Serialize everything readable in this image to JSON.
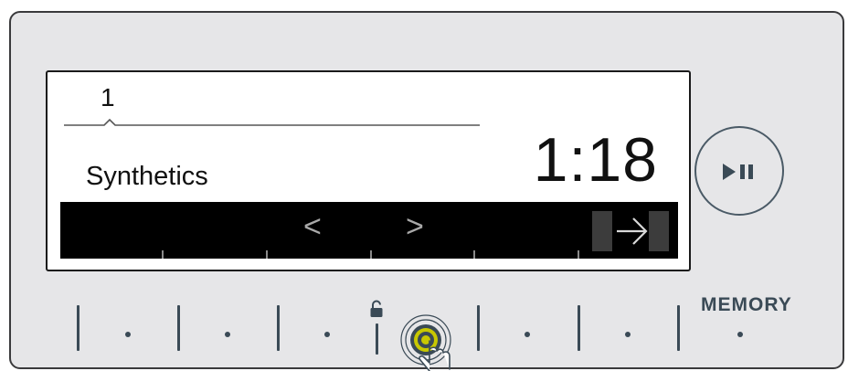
{
  "display": {
    "program_number": "1",
    "program_name": "Synthetics",
    "time_remaining": "1:18"
  },
  "nav": {
    "prev_glyph": "<",
    "next_glyph": ">",
    "forward_icon": "arrow-right-icon"
  },
  "controls": {
    "play_pause_icon": "play-pause-icon",
    "memory_label": "MEMORY",
    "lock_icon": "lock-icon",
    "start_icon": "start-touch-icon"
  },
  "colors": {
    "panel": "#e6e6e8",
    "control_ink": "#3a4a56",
    "start_accent": "#c8c800"
  }
}
